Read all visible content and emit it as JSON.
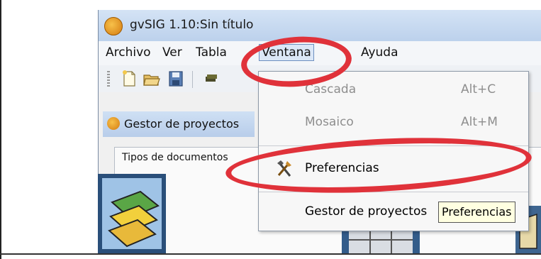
{
  "window": {
    "title": "gvSIG 1.10:Sin título"
  },
  "menubar": {
    "items": [
      {
        "label": "Archivo"
      },
      {
        "label": "Ver"
      },
      {
        "label": "Tabla"
      },
      {
        "label": "Ventana"
      },
      {
        "label": "Ayuda"
      }
    ]
  },
  "inner_window": {
    "title": "Gestor de proyectos"
  },
  "panel": {
    "label": "Tipos de documentos"
  },
  "dropdown": {
    "items": [
      {
        "label": "Cascada",
        "accel": "Alt+C",
        "enabled": false
      },
      {
        "label": "Mosaico",
        "accel": "Alt+M",
        "enabled": false
      },
      {
        "label": "Preferencias",
        "accel": "",
        "enabled": true
      },
      {
        "label": "Gestor de proyectos",
        "accel": "",
        "enabled": true
      }
    ]
  },
  "tooltip": {
    "text": "Preferencias"
  },
  "toolbar": {
    "icons": [
      "new-file-icon",
      "open-folder-icon",
      "save-icon",
      "layer-icon"
    ]
  },
  "colors": {
    "highlight_ring": "#e0323a",
    "titlebar": "#cfe0f4"
  }
}
